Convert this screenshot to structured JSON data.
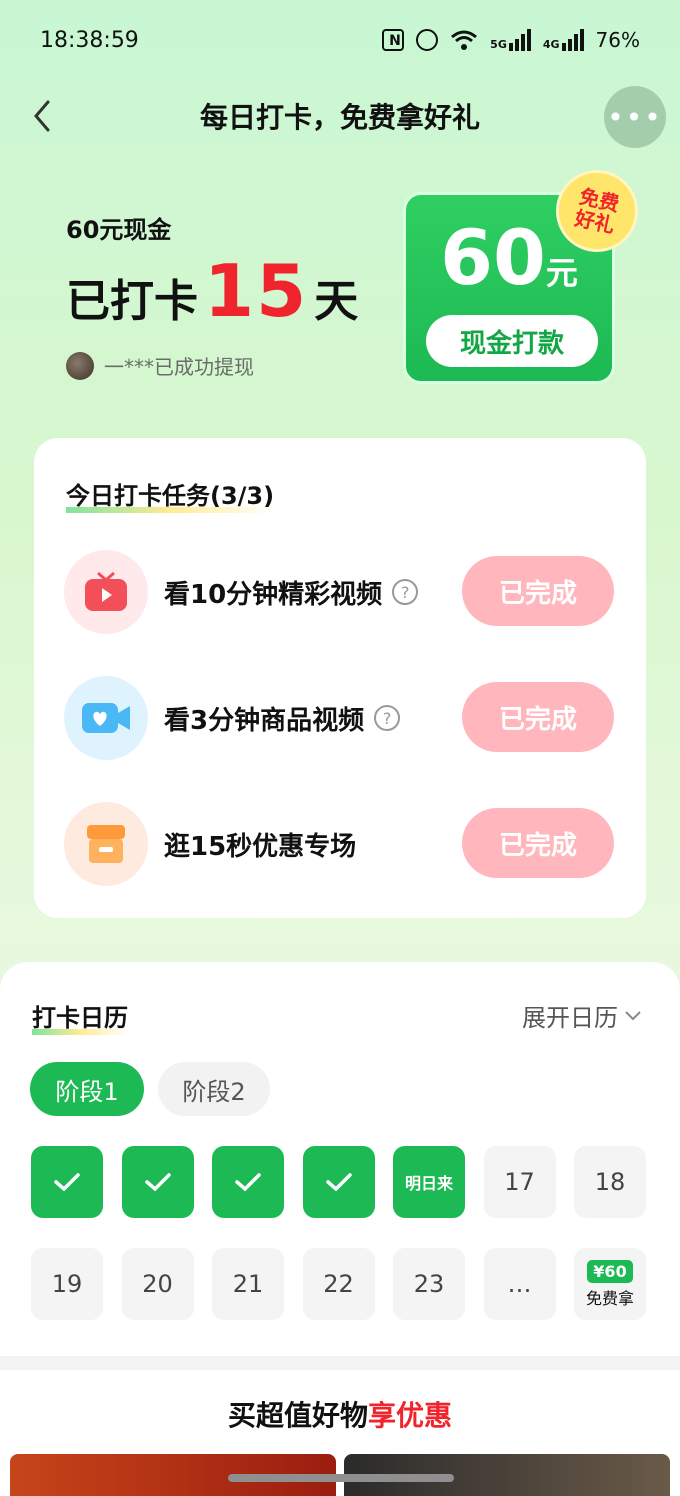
{
  "status_bar": {
    "time": "18:38:59",
    "net1": "5G",
    "net2": "4G",
    "battery": "76%"
  },
  "nav": {
    "title": "每日打卡，免费拿好礼",
    "more_label": "•••"
  },
  "hero": {
    "label": "60元现金",
    "days_prefix": "已打卡",
    "days_count": "15",
    "days_suffix": "天",
    "user_text": "一***已成功提现"
  },
  "cash_card": {
    "amount": "60",
    "unit": "元",
    "button": "现金打款",
    "badge_line1": "免费",
    "badge_line2": "好礼"
  },
  "tasks": {
    "title": "今日打卡任务(3/3)",
    "items": [
      {
        "label": "看10分钟精彩视频",
        "button": "已完成",
        "icon": "tv-icon",
        "has_help": true,
        "icon_bg": "#ffe9ea",
        "icon_color": "#f24f59"
      },
      {
        "label": "看3分钟商品视频",
        "button": "已完成",
        "icon": "video-camera-icon",
        "has_help": true,
        "icon_bg": "#dff3ff",
        "icon_color": "#4ab8f5"
      },
      {
        "label": "逛15秒优惠专场",
        "button": "已完成",
        "icon": "store-icon",
        "has_help": false,
        "icon_bg": "#ffeadf",
        "icon_color": "#ff9a3c"
      }
    ]
  },
  "calendar": {
    "title": "打卡日历",
    "expand": "展开日历",
    "stage1": "阶段1",
    "stage2": "阶段2",
    "days": [
      {
        "label": "",
        "state": "done"
      },
      {
        "label": "",
        "state": "done"
      },
      {
        "label": "",
        "state": "done"
      },
      {
        "label": "",
        "state": "done"
      },
      {
        "label": "明日来",
        "state": "tomorrow"
      },
      {
        "label": "17",
        "state": "future"
      },
      {
        "label": "18",
        "state": "future"
      },
      {
        "label": "19",
        "state": "future"
      },
      {
        "label": "20",
        "state": "future"
      },
      {
        "label": "21",
        "state": "future"
      },
      {
        "label": "22",
        "state": "future"
      },
      {
        "label": "23",
        "state": "future"
      },
      {
        "label": "…",
        "state": "future"
      },
      {
        "label": "免费拿",
        "state": "prize",
        "tag": "¥60"
      }
    ]
  },
  "goods": {
    "title_part1": "买超值好物",
    "title_part2": "享优惠"
  },
  "colors": {
    "brand_green": "#1db954",
    "accent_red": "#f0242d",
    "done_pink": "#ffb7bd"
  }
}
